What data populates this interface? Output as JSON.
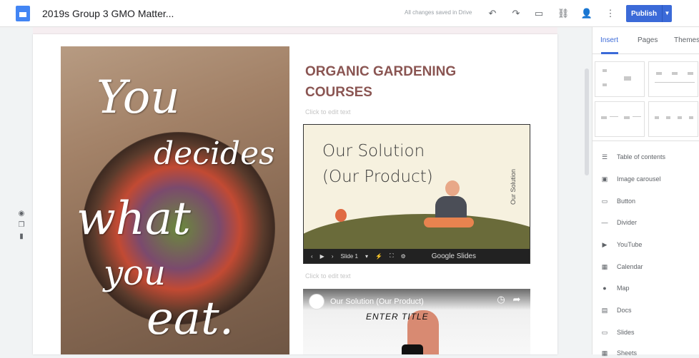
{
  "header": {
    "title": "2019s Group 3 GMO Matter...",
    "save_status": "All changes saved in Drive",
    "publish_label": "Publish",
    "icons": [
      "undo-icon",
      "redo-icon",
      "preview-icon",
      "link-icon",
      "share-icon",
      "more-icon",
      "publish-caret-icon"
    ]
  },
  "hero": {
    "words": [
      "You",
      "decides",
      "what",
      "you",
      "eat."
    ]
  },
  "content": {
    "course_title_line1": "ORGANIC GARDENING",
    "course_title_line2": "COURSES",
    "edit_hint_1": "Click to edit text",
    "edit_hint_2": "Click to edit text"
  },
  "slides": {
    "heading_line1": "Our Solution",
    "heading_line2": "(Our Product)",
    "vertical_text": "Our Solution",
    "slide_label": "Slide 1",
    "brand": "Google Slides"
  },
  "youtube": {
    "title": "Our Solution (Our Product)",
    "overlay_text": "ENTER    TITLE"
  },
  "sidebar": {
    "tabs": [
      "Insert",
      "Pages",
      "Themes"
    ],
    "active_tab": "Insert",
    "insert_items": [
      {
        "label": "Table of contents",
        "icon": "table-of-contents-icon"
      },
      {
        "label": "Image carousel",
        "icon": "image-carousel-icon"
      },
      {
        "label": "Button",
        "icon": "button-icon"
      },
      {
        "label": "Divider",
        "icon": "divider-icon"
      },
      {
        "label": "YouTube",
        "icon": "youtube-icon"
      },
      {
        "label": "Calendar",
        "icon": "calendar-icon"
      },
      {
        "label": "Map",
        "icon": "map-icon"
      },
      {
        "label": "Docs",
        "icon": "docs-icon"
      },
      {
        "label": "Slides",
        "icon": "slides-icon"
      },
      {
        "label": "Sheets",
        "icon": "sheets-icon"
      }
    ]
  },
  "colors": {
    "accent": "#3b6ad8",
    "title": "#8a5552"
  }
}
